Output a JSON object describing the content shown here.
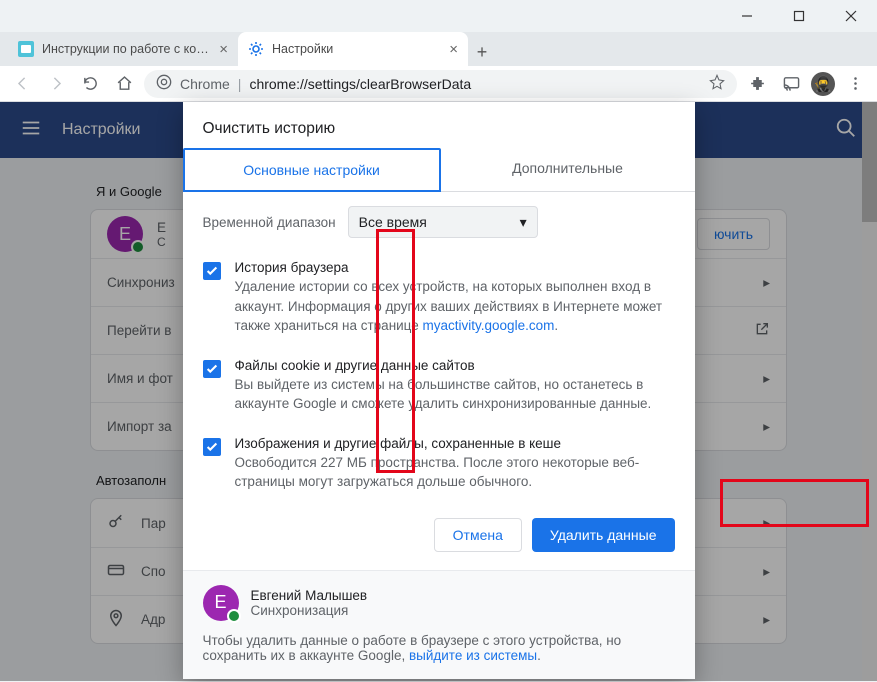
{
  "window": {
    "tabs": [
      {
        "title": "Инструкции по работе с компь",
        "active": false
      },
      {
        "title": "Настройки",
        "active": true
      }
    ]
  },
  "toolbar": {
    "chrome_label": "Chrome",
    "url": "chrome://settings/clearBrowserData"
  },
  "settings": {
    "title": "Настройки",
    "section1": "Я и Google",
    "account_initial": "Е",
    "account_line1": "Е",
    "account_line2": "С",
    "enable_btn": "ючить",
    "rows": [
      "Синхрониз",
      "Перейти в",
      "Имя и фот",
      "Импорт за"
    ],
    "section2": "Автозаполн",
    "rows2": [
      "Пар",
      "Спо",
      "Адр"
    ]
  },
  "dialog": {
    "title": "Очистить историю",
    "tab_basic": "Основные настройки",
    "tab_advanced": "Дополнительные",
    "range_label": "Временной диапазон",
    "range_value": "Все время",
    "opt1_head": "История браузера",
    "opt1_desc_a": "Удаление истории со всех устройств, на которых выполнен вход в аккаунт. Информация о других ваших действиях в Интернете может также храниться на странице ",
    "opt1_link": "myactivity.google.com",
    "opt2_head": "Файлы cookie и другие данные сайтов",
    "opt2_desc": "Вы выйдете из системы на большинстве сайтов, но останетесь в аккаунте Google и сможете удалить синхронизированные данные.",
    "opt3_head": "Изображения и другие файлы, сохраненные в кеше",
    "opt3_desc": "Освободится 227 МБ пространства. После этого некоторые веб-страницы могут загружаться дольше обычного.",
    "cancel": "Отмена",
    "confirm": "Удалить данные",
    "user_name": "Евгений Малышев",
    "user_sub": "Синхронизация",
    "footer_a": "Чтобы удалить данные о работе в браузере с этого устройства, но сохранить их в аккаунте Google, ",
    "footer_link": "выйдите из системы",
    "footer_b": "."
  }
}
